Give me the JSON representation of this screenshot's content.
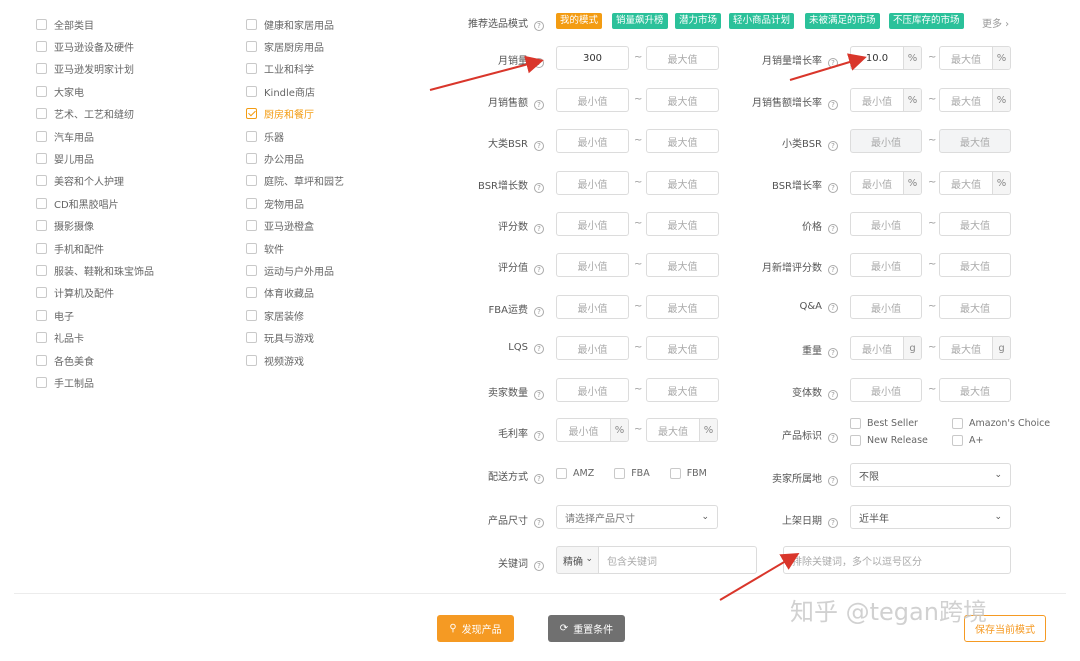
{
  "categories_left": [
    {
      "label": "全部类目",
      "checked": false
    },
    {
      "label": "亚马逊设备及硬件",
      "checked": false
    },
    {
      "label": "亚马逊发明家计划",
      "checked": false
    },
    {
      "label": "大家电",
      "checked": false
    },
    {
      "label": "艺术、工艺和缝纫",
      "checked": false
    },
    {
      "label": "汽车用品",
      "checked": false
    },
    {
      "label": "婴儿用品",
      "checked": false
    },
    {
      "label": "美容和个人护理",
      "checked": false
    },
    {
      "label": "CD和黑胶唱片",
      "checked": false
    },
    {
      "label": "摄影摄像",
      "checked": false
    },
    {
      "label": "手机和配件",
      "checked": false
    },
    {
      "label": "服装、鞋靴和珠宝饰品",
      "checked": false
    },
    {
      "label": "计算机及配件",
      "checked": false
    },
    {
      "label": "电子",
      "checked": false
    },
    {
      "label": "礼品卡",
      "checked": false
    },
    {
      "label": "各色美食",
      "checked": false
    },
    {
      "label": "手工制品",
      "checked": false
    }
  ],
  "categories_right": [
    {
      "label": "健康和家居用品",
      "checked": false
    },
    {
      "label": "家居厨房用品",
      "checked": false
    },
    {
      "label": "工业和科学",
      "checked": false
    },
    {
      "label": "Kindle商店",
      "checked": false
    },
    {
      "label": "厨房和餐厅",
      "checked": true
    },
    {
      "label": "乐器",
      "checked": false
    },
    {
      "label": "办公用品",
      "checked": false
    },
    {
      "label": "庭院、草坪和园艺",
      "checked": false
    },
    {
      "label": "宠物用品",
      "checked": false
    },
    {
      "label": "亚马逊橙盒",
      "checked": false
    },
    {
      "label": "软件",
      "checked": false
    },
    {
      "label": "运动与户外用品",
      "checked": false
    },
    {
      "label": "体育收藏品",
      "checked": false
    },
    {
      "label": "家居装修",
      "checked": false
    },
    {
      "label": "玩具与游戏",
      "checked": false
    },
    {
      "label": "视频游戏",
      "checked": false
    }
  ],
  "mode": {
    "label": "推荐选品模式",
    "tags": [
      "我的模式",
      "销量飙升榜",
      "潜力市场",
      "轻小商品计划",
      "未被满足的市场",
      "不压库存的市场"
    ],
    "more": "更多 ›"
  },
  "placeholders": {
    "min": "最小值",
    "max": "最大值"
  },
  "units": {
    "percent": "%",
    "gram": "g"
  },
  "dash": "~",
  "fields": {
    "monthly_sales": {
      "label": "月销量",
      "min_value": "300"
    },
    "monthly_sales_growth": {
      "label": "月销量增长率",
      "min_value": "10.0"
    },
    "monthly_revenue": {
      "label": "月销售额"
    },
    "monthly_revenue_growth": {
      "label": "月销售额增长率"
    },
    "main_bsr": {
      "label": "大类BSR"
    },
    "sub_bsr": {
      "label": "小类BSR"
    },
    "bsr_growth_count": {
      "label": "BSR增长数"
    },
    "bsr_growth_rate": {
      "label": "BSR增长率"
    },
    "review_count": {
      "label": "评分数"
    },
    "price": {
      "label": "价格"
    },
    "rating": {
      "label": "评分值"
    },
    "monthly_new_reviews": {
      "label": "月新增评分数"
    },
    "fba_fee": {
      "label": "FBA运费"
    },
    "qa": {
      "label": "Q&A"
    },
    "lqs": {
      "label": "LQS"
    },
    "weight": {
      "label": "重量"
    },
    "seller_count": {
      "label": "卖家数量"
    },
    "variant_count": {
      "label": "变体数"
    },
    "gross_margin": {
      "label": "毛利率"
    },
    "product_badge": {
      "label": "产品标识",
      "options": [
        "Best Seller",
        "Amazon's Choice",
        "New Release",
        "A+"
      ]
    },
    "fulfillment": {
      "label": "配送方式",
      "options": [
        "AMZ",
        "FBA",
        "FBM"
      ]
    },
    "seller_location": {
      "label": "卖家所属地",
      "value": "不限"
    },
    "product_size": {
      "label": "产品尺寸",
      "value": "请选择产品尺寸"
    },
    "listing_date": {
      "label": "上架日期",
      "value": "近半年"
    },
    "keyword": {
      "label": "关键词",
      "match": "精确",
      "include_placeholder": "包含关键词",
      "exclude_placeholder": "排除关键词，多个以逗号区分"
    }
  },
  "buttons": {
    "find": "发现产品",
    "reset": "重置条件",
    "save": "保存当前模式"
  },
  "watermark": "知乎 @tegan跨境",
  "colors": {
    "accent": "#f39c12",
    "tag_green": "#2bc19a",
    "arrow": "#d9362b"
  }
}
